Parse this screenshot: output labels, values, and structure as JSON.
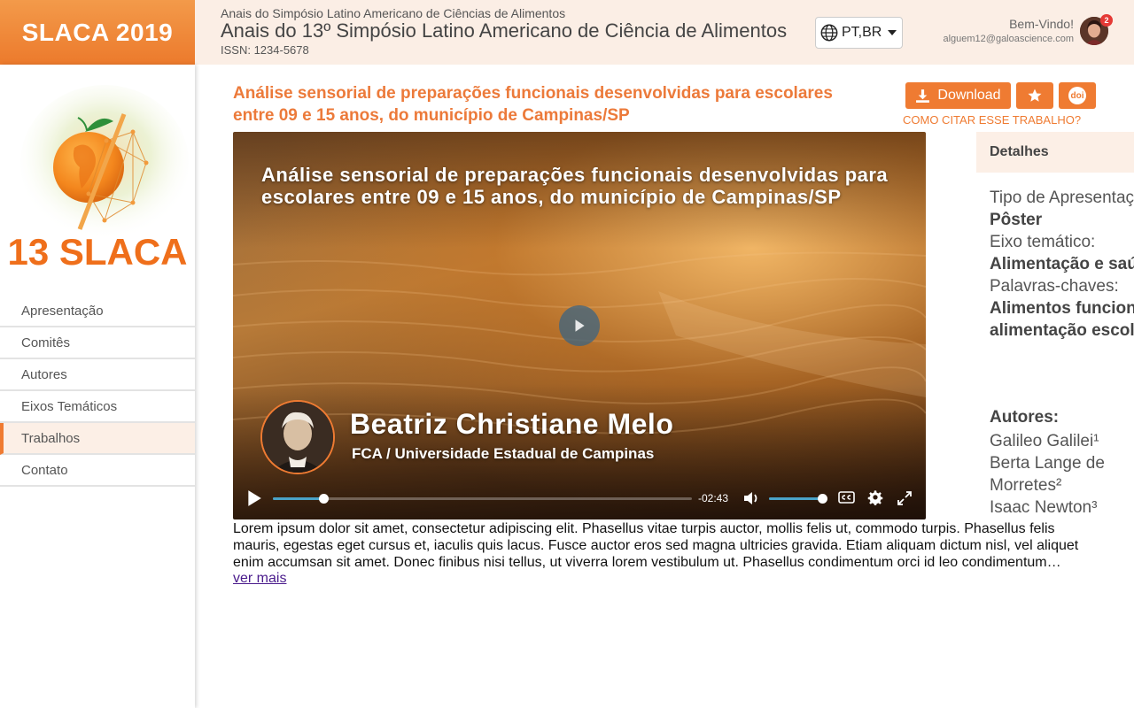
{
  "header": {
    "brand": "SLACA 2019",
    "publication_subtitle": "Anais do Simpósio Latino Americano de Ciências de Alimentos",
    "publication_title": "Anais do 13º Simpósio Latino Americano de Ciência de Alimentos",
    "issn": "ISSN: 1234-5678",
    "language": "PT,BR",
    "welcome": "Bem-Vindo!",
    "user_email": "alguem12@galoascience.com",
    "notification_count": "2"
  },
  "sidebar": {
    "logo_text": "13 SLACA",
    "items": [
      {
        "label": "Apresentação",
        "active": false
      },
      {
        "label": "Comitês",
        "active": false
      },
      {
        "label": "Autores",
        "active": false
      },
      {
        "label": "Eixos Temáticos",
        "active": false
      },
      {
        "label": "Trabalhos",
        "active": true
      },
      {
        "label": "Contato",
        "active": false
      }
    ]
  },
  "work": {
    "title": "Análise sensorial de preparações funcionais desenvolvidas para escolares entre 09 e 15 anos, do município de Campinas/SP",
    "download_label": "Download",
    "cite_label": "COMO CITAR ESSE TRABALHO?",
    "doi_label": "doi"
  },
  "video": {
    "title": "Análise sensorial de preparações funcionais desenvolvidas para escolares entre 09 e 15 anos, do município de Campinas/SP",
    "presenter_name": "Beatriz Christiane Melo",
    "presenter_affiliation": "FCA / Universidade Estadual de Campinas",
    "time_remaining": "-02:43",
    "progress_fraction": 0.12,
    "volume_fraction": 0.95
  },
  "details": {
    "header": "Detalhes",
    "presentation_type_label": "Tipo de Apresentação:",
    "presentation_type": "Pôster",
    "theme_label": "Eixo temático:",
    "theme": "Alimentação e saúde (AS)",
    "keywords_label": "Palavras-chaves:",
    "keywords": "Alimentos funcionais, alimentação escolar",
    "authors_label": "Autores:",
    "authors": [
      "Galileo Galilei¹",
      "Berta Lange de Morretes²",
      "Isaac Newton³"
    ]
  },
  "abstract": {
    "text": "Lorem ipsum dolor sit amet, consectetur adipiscing elit. Phasellus vitae turpis auctor, mollis felis ut, commodo turpis. Phasellus felis mauris, egestas eget cursus et, iaculis quis lacus. Fusce auctor eros sed magna ultricies gravida. Etiam aliquam dictum nisl, vel aliquet enim accumsan sit amet. Donec finibus nisi tellus, ut viverra lorem vestibulum ut. Phasellus condimentum orci id leo condimentum…",
    "more_label": "ver mais"
  },
  "colors": {
    "accent": "#ef7b32",
    "title": "#ec7a3a",
    "player_accent": "#4aa3c8"
  }
}
